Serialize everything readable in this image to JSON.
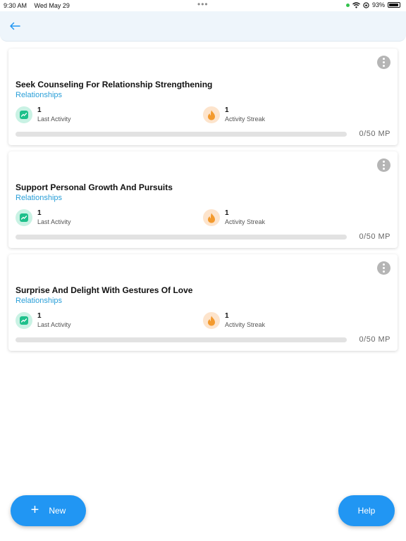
{
  "status_bar": {
    "time": "9:30 AM",
    "date": "Wed May 29",
    "battery": "93%"
  },
  "cards": [
    {
      "title": "Seek Counseling For Relationship Strengthening",
      "category": "Relationships",
      "last_activity_value": "1",
      "last_activity_label": "Last Activity",
      "streak_value": "1",
      "streak_label": "Activity Streak",
      "progress_text": "0/50 MP",
      "progress_fraction": 0
    },
    {
      "title": "Support Personal Growth And Pursuits",
      "category": "Relationships",
      "last_activity_value": "1",
      "last_activity_label": "Last Activity",
      "streak_value": "1",
      "streak_label": "Activity Streak",
      "progress_text": "0/50 MP",
      "progress_fraction": 0
    },
    {
      "title": "Surprise And Delight With Gestures Of Love",
      "category": "Relationships",
      "last_activity_value": "1",
      "last_activity_label": "Last Activity",
      "streak_value": "1",
      "streak_label": "Activity Streak",
      "progress_text": "0/50 MP",
      "progress_fraction": 0
    }
  ],
  "buttons": {
    "new_label": "New",
    "help_label": "Help"
  },
  "colors": {
    "accent": "#2196f3",
    "category": "#2a9fd8",
    "header_bg": "#eef5fb"
  }
}
